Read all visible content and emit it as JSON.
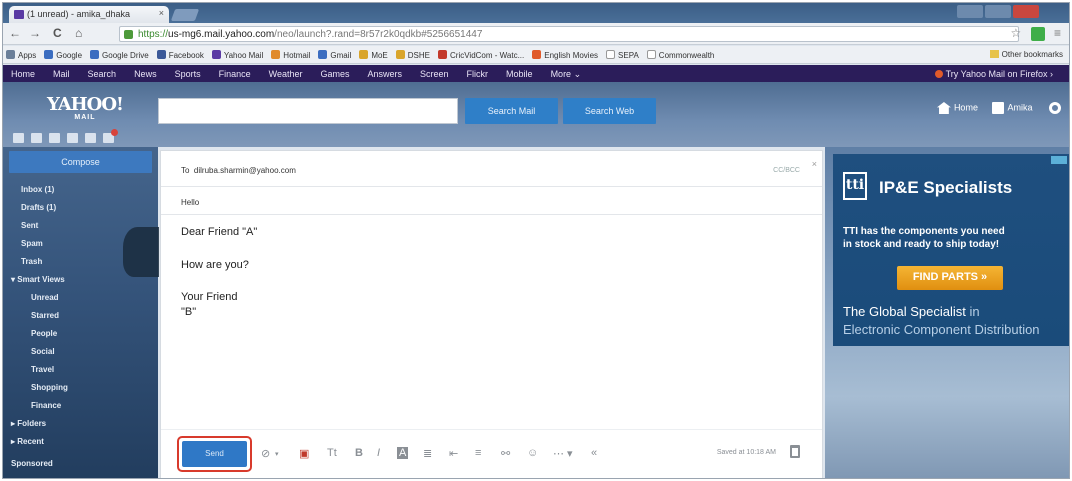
{
  "browser": {
    "tab_title": "(1 unread) - amika_dhaka",
    "tab_close": "×",
    "url_https": "https://",
    "url_host": "us-mg6.mail.yahoo.com",
    "url_path": "/neo/launch?.rand=8r57r2k0qdkb#5256651447",
    "nav": {
      "back": "←",
      "forward": "→",
      "reload": "C",
      "home": "⌂"
    },
    "star": "☆",
    "menu": "≡"
  },
  "bookmarks": {
    "items": [
      {
        "label": "Apps",
        "color": "#6b7f99"
      },
      {
        "label": "Google",
        "color": "#3b6dc0"
      },
      {
        "label": "Google Drive",
        "color": "#3b6dc0"
      },
      {
        "label": "Facebook",
        "color": "#3b5998"
      },
      {
        "label": "Yahoo Mail",
        "color": "#5a3aa4"
      },
      {
        "label": "Hotmail",
        "color": "#e08a2c"
      },
      {
        "label": "Gmail",
        "color": "#3b6dc0"
      },
      {
        "label": "MoE",
        "color": "#d9a52b"
      },
      {
        "label": "DSHE",
        "color": "#d9a52b"
      },
      {
        "label": "CricVidCom - Watc...",
        "color": "#c33a2b"
      },
      {
        "label": "English Movies",
        "color": "#e05a2a"
      },
      {
        "label": "SEPA",
        "color": "#ffffff"
      },
      {
        "label": "Commonwealth",
        "color": "#ffffff"
      }
    ],
    "other": "Other bookmarks"
  },
  "yahoo_nav": {
    "items": [
      "Home",
      "Mail",
      "Search",
      "News",
      "Sports",
      "Finance",
      "Weather",
      "Games",
      "Answers",
      "Screen",
      "Flickr",
      "Mobile",
      "More ⌄"
    ],
    "try_firefox": "Try Yahoo Mail on Firefox ›"
  },
  "header": {
    "logo": "YAHOO!",
    "logo_sub": "MAIL",
    "search_placeholder": "",
    "search_mail": "Search Mail",
    "search_web": "Search Web",
    "home": "Home",
    "user": "Amika"
  },
  "sidebar": {
    "compose": "Compose",
    "folders": [
      {
        "label": "Inbox (1)",
        "level": "top"
      },
      {
        "label": "Drafts (1)",
        "level": "top"
      },
      {
        "label": "Sent",
        "level": "top"
      },
      {
        "label": "Spam",
        "level": "top"
      },
      {
        "label": "Trash",
        "level": "top"
      },
      {
        "label": "▾ Smart Views",
        "level": "hdr"
      },
      {
        "label": "Unread",
        "level": "sub"
      },
      {
        "label": "Starred",
        "level": "sub"
      },
      {
        "label": "People",
        "level": "sub"
      },
      {
        "label": "Social",
        "level": "sub"
      },
      {
        "label": "Travel",
        "level": "sub"
      },
      {
        "label": "Shopping",
        "level": "sub"
      },
      {
        "label": "Finance",
        "level": "sub"
      },
      {
        "label": "▸ Folders",
        "level": "hdr"
      },
      {
        "label": "▸ Recent",
        "level": "hdr"
      },
      {
        "label": "Sponsored",
        "level": "hdr"
      }
    ]
  },
  "compose": {
    "to_label": "To",
    "to_value": "dilruba.sharmin@yahoo.com",
    "cc_bcc": "CC/BCC",
    "close": "×",
    "subject": "Hello",
    "body": {
      "greeting": "Dear Friend \"A\"",
      "question": "How are you?",
      "closing": "Your Friend",
      "signature": "\"B\""
    },
    "send": "Send",
    "saved": "Saved at 10:18 AM"
  },
  "toolbar_icons": {
    "attach": "⊘",
    "attach_caret": "▾",
    "photo": "▣",
    "text_size": "Tt",
    "bold": "B",
    "italic": "I",
    "color": "A",
    "bullets": "≣",
    "indent": "⇤",
    "align": "≡",
    "link": "⚯",
    "emoji": "☺",
    "more": "⋯ ▾",
    "collapse": "«"
  },
  "ad": {
    "logo": "tti",
    "headline": "IP&E Specialists",
    "line1": "TTI has the components you need",
    "line2": "in stock and ready to ship today!",
    "cta": "FIND PARTS »",
    "tag_main": "The Global Specialist",
    "tag_in": " in",
    "tag_rest": "Electronic Component Distribution"
  }
}
